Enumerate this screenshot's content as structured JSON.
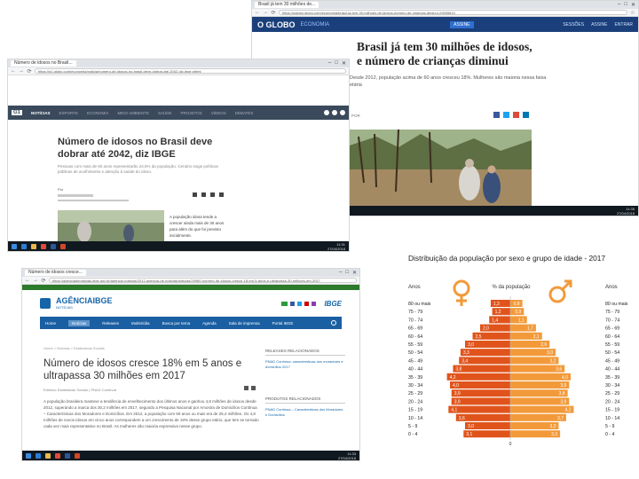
{
  "oglobo": {
    "tab": "Brasil já tem 30 milhões de...",
    "url": "https://oglobo.globo.com/economia/brasil-ja-tem-30-milhoes-de-idosos-numero-de-criancas-diminui-22655813",
    "brand": "O GLOBO",
    "section": "ECONOMIA",
    "banner": "ASSINE",
    "nav": [
      "SESSÕES",
      "ASSINE",
      "ENTRAR"
    ],
    "headline": "Brasil já tem 30 milhões de idosos, e número de crianças diminui",
    "subhead": "Desde 2012, população acima de 60 anos cresceu 18%. Mulheres são maioria nessa faixa etária",
    "byline": "POR",
    "clock": {
      "time": "11:35",
      "date": "27/04/2018"
    }
  },
  "g1": {
    "tab": "Número de idosos no Brasil...",
    "url": "https://g1.globo.com/economia/noticia/numero-de-idosos-no-brasil-deve-dobrar-ate-2042-diz-ibge.ghtml",
    "logo": "G1",
    "nav": [
      "NOTÍCIAS",
      "ESPORTE",
      "ECONOMIA",
      "MEIO AMBIENTE",
      "SAÚDE",
      "PROJETOS",
      "VÍDEOS",
      "DEBATES"
    ],
    "headline": "Número de idosos no Brasil deve dobrar até 2042, diz IBGE",
    "subhead": "Pessoas com mais de 60 anos representarão 24,5% da população. Cenário exige políticas públicas de acolhimento e atenção à saúde do idoso.",
    "author": "Por",
    "body": "A população idosa tende a crescer ainda mais de 30 anos para além do que foi previsto inicialmente.",
    "clock": {
      "time": "11:31",
      "date": "27/04/2018"
    }
  },
  "ibge": {
    "tab": "Número de idosos cresce...",
    "url": "https://agenciadenoticias.ibge.gov.br/agencia-noticias/2012-agencia-de-noticias/noticias/20980-numero-de-idosos-cresce-18-em-5-anos-e-ultrapassa-30-milhoes-em-2017",
    "logo": "AGÊNCIAIBGE",
    "logo_sub": "NOTÍCIAS",
    "gov": "IBGE",
    "nav": [
      "Home",
      "Notícias",
      "Releases",
      "Multimídia",
      "Busca por tema",
      "Agenda",
      "Sala de imprensa",
      "Portal IBGE"
    ],
    "breadcrumb": "Home > Notícias > Estatísticas Sociais",
    "headline": "Número de idosos cresce 18% em 5 anos e ultrapassa 30 milhões em 2017",
    "meta": "Editoria: Estatísticas Sociais | PNAD Contínua",
    "body": "A população brasileira manteve a tendência de envelhecimento dos últimos anos e ganhou 4,8 milhões de idosos desde 2012, superando a marca dos 30,2 milhões em 2017, segundo a Pesquisa Nacional por Amostra de Domicílios Contínua – Características dos Moradores e Domicílios. Em 2012, a população com 60 anos ou mais era de 25,4 milhões. Os 4,8 milhões de novos idosos em cinco anos correspondem a um crescimento de 18% desse grupo etário, que tem se tornado cada vez mais representativo no Brasil. As mulheres são maioria expressiva nesse grupo.",
    "sidebar1": "RELEASES RELACIONADOS",
    "sidebar1_text": "PNAD Contínua: características dos moradores e domicílios 2017",
    "sidebar2": "PRODUTOS RELACIONADOS",
    "sidebar2_text": "PNAD Contínua – Características dos Moradores e Domicílios",
    "clock": {
      "time": "11:33",
      "date": "27/04/2018"
    }
  },
  "chart_data": {
    "type": "bar",
    "title": "Distribuição da população por sexo e grupo de idade - 2017",
    "left_header": "Anos",
    "center_header": "% da população",
    "right_header": "Anos",
    "categories": [
      "80 ou mais",
      "75 - 79",
      "70 - 74",
      "65 - 69",
      "60 - 64",
      "55 - 59",
      "50 - 54",
      "45 - 49",
      "40 - 44",
      "35 - 39",
      "30 - 34",
      "25 - 29",
      "20 - 24",
      "15 - 19",
      "10 - 14",
      "5 - 9",
      "0 - 4"
    ],
    "series": [
      {
        "name": "female",
        "values": [
          1.3,
          1.2,
          1.4,
          2.0,
          2.5,
          3.0,
          3.3,
          3.4,
          3.8,
          4.2,
          4.0,
          3.9,
          3.9,
          4.1,
          3.6,
          3.0,
          3.1
        ]
      },
      {
        "name": "male",
        "values": [
          0.8,
          0.9,
          1.1,
          1.7,
          2.1,
          2.6,
          3.0,
          3.2,
          3.6,
          4.0,
          3.9,
          3.8,
          3.9,
          4.2,
          3.7,
          3.2,
          3.3
        ]
      }
    ],
    "value_labels_female": [
      "1,3",
      "1,2",
      "1,4",
      "2,0",
      "2,5",
      "3,0",
      "3,3",
      "3,4",
      "3,8",
      "4,2",
      "4,0",
      "3,9",
      "3,9",
      "4,1",
      "3,6",
      "3,0",
      "3,1"
    ],
    "value_labels_male": [
      "0,8",
      "0,9",
      "1,1",
      "1,7",
      "2,1",
      "2,6",
      "3,0",
      "3,2",
      "3,6",
      "4,0",
      "3,9",
      "3,8",
      "3,9",
      "4,2",
      "3,7",
      "3,2",
      "3,3"
    ],
    "zero_label": "0",
    "colors": {
      "female": "#e0541c",
      "male": "#f29a3a",
      "female_dark": "#c94516"
    }
  }
}
